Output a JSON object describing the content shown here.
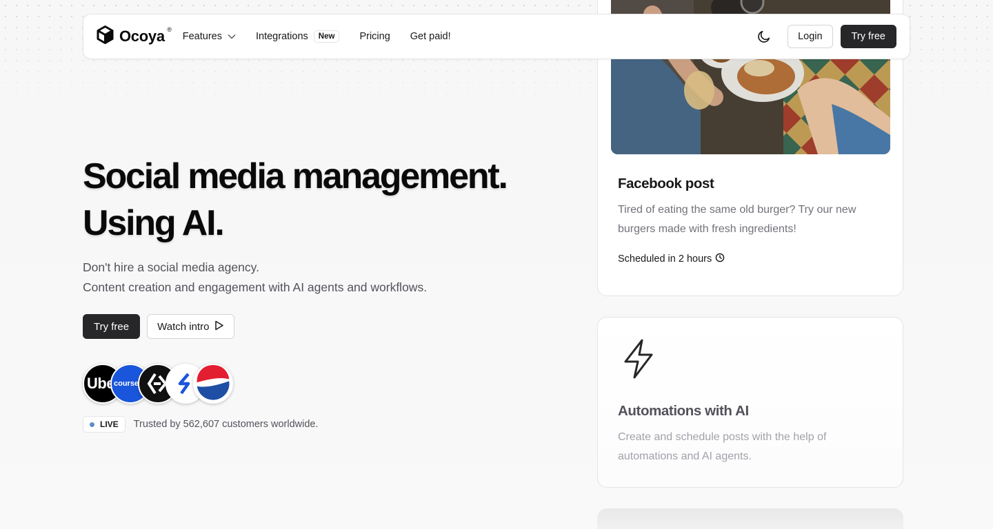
{
  "nav": {
    "brand": "Ocoya",
    "brand_mark": "®",
    "links": [
      {
        "label": "Features"
      },
      {
        "label": "Integrations",
        "badge": "New"
      },
      {
        "label": "Pricing"
      },
      {
        "label": "Get paid!"
      }
    ],
    "login_label": "Login",
    "try_free_label": "Try free"
  },
  "hero": {
    "title_line1": "Social media management.",
    "title_line2": "Using AI.",
    "subtitle_line1": "Don't hire a social media agency.",
    "subtitle_line2": "Content creation and engagement with AI agents and workflows.",
    "cta_primary": "Try free",
    "cta_secondary": "Watch intro",
    "logos": [
      {
        "name": "Uber",
        "text": "Uber"
      },
      {
        "name": "Coursera",
        "text": "coursera"
      },
      {
        "name": "Dark brand logo"
      },
      {
        "name": "Blue brand logo"
      },
      {
        "name": "Pepsi"
      }
    ],
    "live_label": "LIVE",
    "trusted_text": "Trusted by 562,607 customers worldwide."
  },
  "cards": {
    "post": {
      "title": "Facebook post",
      "text": "Tired of eating the same old burger? Try our new burgers made with fresh ingredients!",
      "scheduled": "Scheduled in 2 hours"
    },
    "automation": {
      "title": "Automations with AI",
      "text": "Create and schedule posts with the help of automations and AI agents."
    }
  },
  "colors": {
    "primary_dark": "#27272a",
    "live_dot": "#5b8fc7",
    "muted_text": "#71717a"
  },
  "icons": [
    "ocoya-cube-icon",
    "chevron-down-icon",
    "moon-icon",
    "play-icon",
    "clock-icon",
    "lightning-bolt-icon"
  ]
}
